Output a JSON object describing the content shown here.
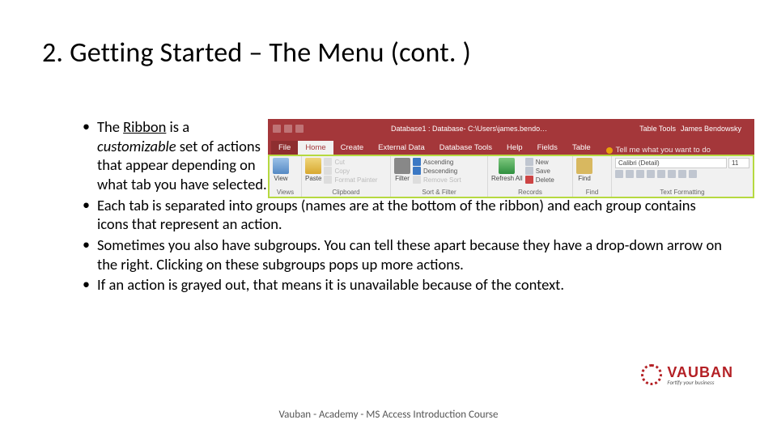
{
  "title": "2. Getting Started – The Menu (cont. )",
  "bullets": {
    "b1_pre": "The ",
    "b1_ribbon": "Ribbon",
    "b1_mid": " is a ",
    "b1_custom": "customizable",
    "b1_post": " set of actions that appear depending on what tab you have selected.",
    "b2": "Each tab is separated into groups (names are at the bottom of the ribbon) and each group contains icons that represent an action.",
    "b3": "Sometimes you also have subgroups. You can tell these apart because they have a drop-down arrow on the right. Clicking on these subgroups pops up more actions.",
    "b4": "If an action is grayed out, that means it is unavailable because of the context."
  },
  "ribbon": {
    "app_title": "Database1 : Database- C:\\Users\\james.bendo…",
    "tool_tab": "Table Tools",
    "user": "James Bendowsky",
    "tabs": {
      "file": "File",
      "home": "Home",
      "create": "Create",
      "external": "External Data",
      "dbtools": "Database Tools",
      "help": "Help",
      "fields": "Fields",
      "table": "Table"
    },
    "tellme": "Tell me what you want to do",
    "groups": {
      "views": {
        "label": "Views",
        "btn": "View"
      },
      "clipboard": {
        "label": "Clipboard",
        "paste": "Paste",
        "cut": "Cut",
        "copy": "Copy",
        "painter": "Format Painter"
      },
      "sortfilter": {
        "label": "Sort & Filter",
        "filter": "Filter",
        "asc": "Ascending",
        "desc": "Descending",
        "rem": "Remove Sort"
      },
      "records": {
        "label": "Records",
        "refresh": "Refresh All",
        "new": "New",
        "save": "Save",
        "del": "Delete"
      },
      "find": {
        "label": "Find",
        "find": "Find"
      },
      "textfmt": {
        "label": "Text Formatting",
        "font": "Calibri (Detail)",
        "size": "11"
      }
    }
  },
  "logo": {
    "name": "VAUBAN",
    "tag": "Fortify your business"
  },
  "footer": "Vauban - Academy - MS Access Introduction Course"
}
